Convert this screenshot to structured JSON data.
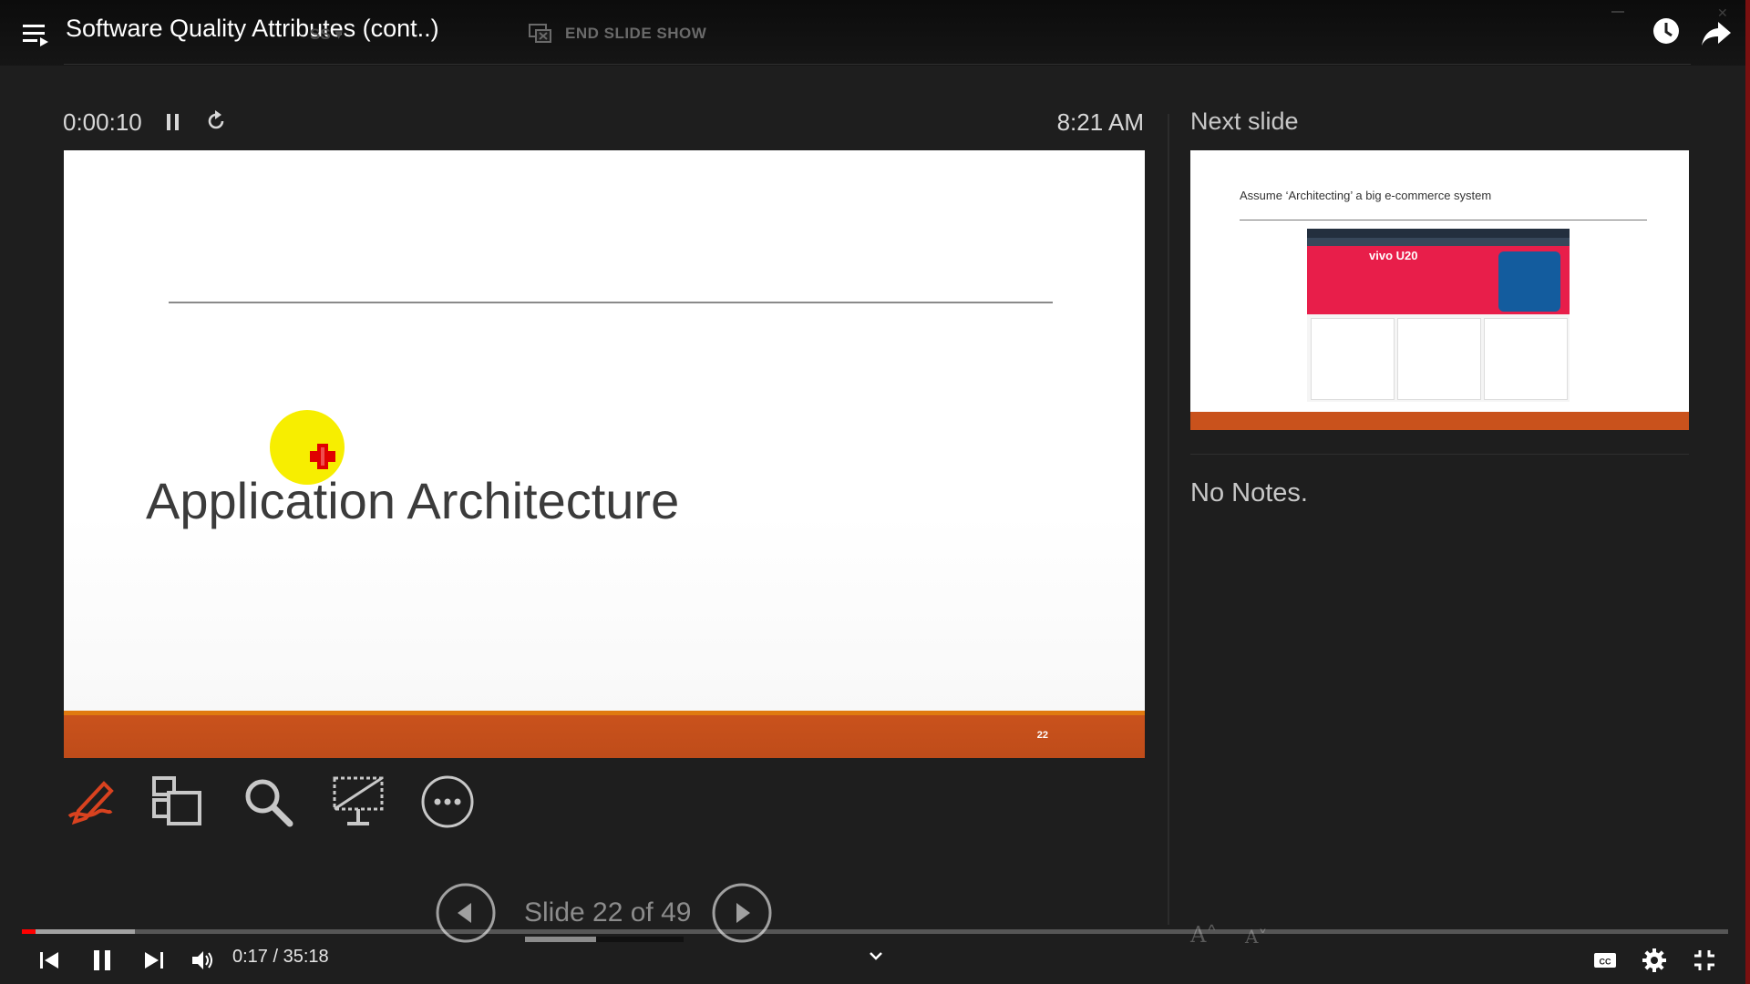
{
  "video": {
    "title": "Software Quality Attributes (cont..)",
    "current_time": "0:17",
    "separator": "/",
    "duration": "35:18",
    "progress_fraction": 0.008,
    "buffered_fraction": 0.066
  },
  "ghost_toolbar": {
    "dropdown_label": "SS ▾",
    "end_slide_show_label": "END SLIDE SHOW"
  },
  "presenter": {
    "timer": "0:00:10",
    "clock": "8:21 AM",
    "next_slide_label": "Next slide",
    "notes": "No Notes.",
    "slide_counter": "Slide 22 of 49",
    "slide_position_fraction": 0.449
  },
  "current_slide": {
    "title": "Application Architecture",
    "number": "22",
    "footer_color": "#c9521c"
  },
  "next_slide": {
    "title": "Assume ‘Architecting’ a big e-commerce system",
    "banner_text": "vivo U20"
  },
  "font_controls": {
    "increase": "A˄",
    "decrease": "A˅"
  },
  "icons": {
    "tools": [
      "pen-icon",
      "slides-grid-icon",
      "zoom-icon",
      "black-screen-icon",
      "more-options-icon"
    ],
    "player": [
      "previous-icon",
      "pause-icon",
      "next-icon",
      "volume-icon",
      "captions-icon",
      "settings-icon",
      "exit-fullscreen-icon"
    ]
  },
  "colors": {
    "youtube_red": "#ff0000",
    "pen_red": "#d9421f",
    "pointer_yellow": "#f7ee00"
  }
}
